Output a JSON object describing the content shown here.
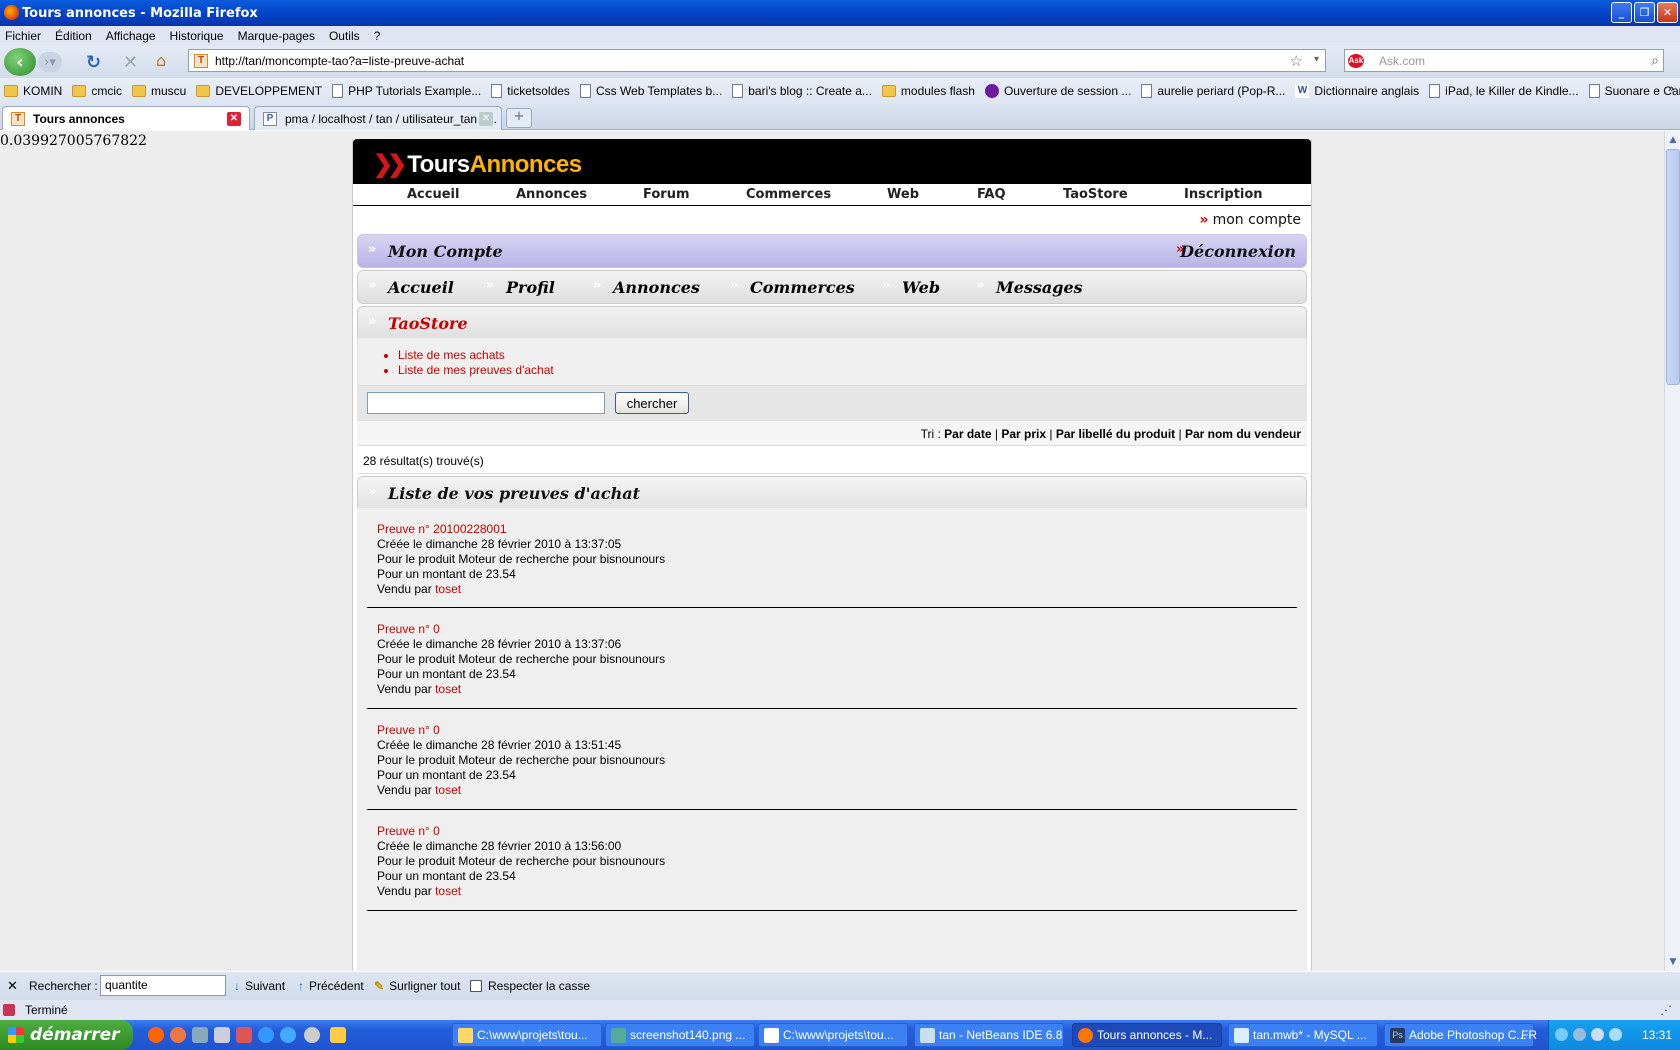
{
  "window": {
    "title": "Tours annonces - Mozilla Firefox"
  },
  "menu": [
    "Fichier",
    "Édition",
    "Affichage",
    "Historique",
    "Marque-pages",
    "Outils",
    "?"
  ],
  "address": {
    "url": "http://tan/moncompte-tao?a=liste-preuve-achat"
  },
  "search": {
    "placeholder": "Ask.com"
  },
  "bookmarks": [
    {
      "label": "KOMIN",
      "icon": "folder-icon"
    },
    {
      "label": "cmcic",
      "icon": "folder-icon"
    },
    {
      "label": "muscu",
      "icon": "folder-icon"
    },
    {
      "label": "DEVELOPPEMENT",
      "icon": "folder-icon"
    },
    {
      "label": "PHP Tutorials Example...",
      "icon": "page-icon"
    },
    {
      "label": "ticketsoldes",
      "icon": "page-icon"
    },
    {
      "label": "Css Web Templates b...",
      "icon": "page-icon"
    },
    {
      "label": "bari's blog :: Create a...",
      "icon": "page-icon"
    },
    {
      "label": "modules flash",
      "icon": "folder-icon"
    },
    {
      "label": "Ouverture de session ...",
      "icon": "yahoo-icon"
    },
    {
      "label": "aurelie periard (Pop-R...",
      "icon": "page-icon"
    },
    {
      "label": "Dictionnaire anglais",
      "icon": "wordreference-icon"
    },
    {
      "label": "iPad, le Killer de Kindle...",
      "icon": "page-icon"
    },
    {
      "label": "Suonare e Cantare su...",
      "icon": "page-icon"
    }
  ],
  "tabs": [
    {
      "label": "Tours annonces"
    },
    {
      "label": "pma / localhost / tan / utilisateur_tan | ..."
    }
  ],
  "page": {
    "timer": "0.039927005767822",
    "logo": {
      "part1": "Tours",
      "part2": "Annonces"
    },
    "topnav": [
      "Accueil",
      "Annonces",
      "Forum",
      "Commerces",
      "Web",
      "FAQ",
      "TaoStore",
      "Inscription"
    ],
    "account_link": "mon compte",
    "account_title": "Mon Compte",
    "logout": "Déconnexion",
    "secnav": [
      "Accueil",
      "Profil",
      "Annonces",
      "Commerces",
      "Web",
      "Messages"
    ],
    "section_title": "TaoStore",
    "section_links": [
      "Liste de mes achats",
      "Liste de mes preuves d'achat"
    ],
    "search_button": "chercher",
    "sort": {
      "label": "Tri :",
      "options": [
        "Par date",
        "Par prix",
        "Par libellé du produit",
        "Par nom du vendeur"
      ]
    },
    "results_count": "28 résultat(s) trouvé(s)",
    "list_title": "Liste de vos preuves d'achat",
    "proofs": [
      {
        "number": "Preuve n° 20100228001",
        "created": "Créée le dimanche 28 février 2010 à 13:37:05",
        "product": "Pour le produit Moteur de recherche pour bisnounours",
        "amount": "Pour un montant de 23.54",
        "sold_by": "Vendu par",
        "seller": "toset"
      },
      {
        "number": "Preuve n° 0",
        "created": "Créée le dimanche 28 février 2010 à 13:37:06",
        "product": "Pour le produit Moteur de recherche pour bisnounours",
        "amount": "Pour un montant de 23.54",
        "sold_by": "Vendu par",
        "seller": "toset"
      },
      {
        "number": "Preuve n° 0",
        "created": "Créée le dimanche 28 février 2010 à 13:51:45",
        "product": "Pour le produit Moteur de recherche pour bisnounours",
        "amount": "Pour un montant de 23.54",
        "sold_by": "Vendu par",
        "seller": "toset"
      },
      {
        "number": "Preuve n° 0",
        "created": "Créée le dimanche 28 février 2010 à 13:56:00",
        "product": "Pour le produit Moteur de recherche pour bisnounours",
        "amount": "Pour un montant de 23.54",
        "sold_by": "Vendu par",
        "seller": "toset"
      }
    ]
  },
  "findbar": {
    "label": "Rechercher :",
    "value": "quantite",
    "next": "Suivant",
    "prev": "Précédent",
    "highlight": "Surligner tout",
    "match_case": "Respecter la casse"
  },
  "status": {
    "text": "Terminé"
  },
  "taskbar": {
    "start": "démarrer",
    "tasks": [
      "C:\\www\\projets\\tou...",
      "screenshot140.png ...",
      "C:\\www\\projets\\tou...",
      "tan - NetBeans IDE 6.8",
      "Tours annonces - M...",
      "tan.mwb* - MySQL ...",
      "Adobe Photoshop C..."
    ],
    "lang": "FR",
    "clock": "13:31"
  },
  "colors": {
    "accent_red": "#cc0000",
    "logo_yellow": "#ffb400",
    "xp_blue": "#245edc"
  }
}
